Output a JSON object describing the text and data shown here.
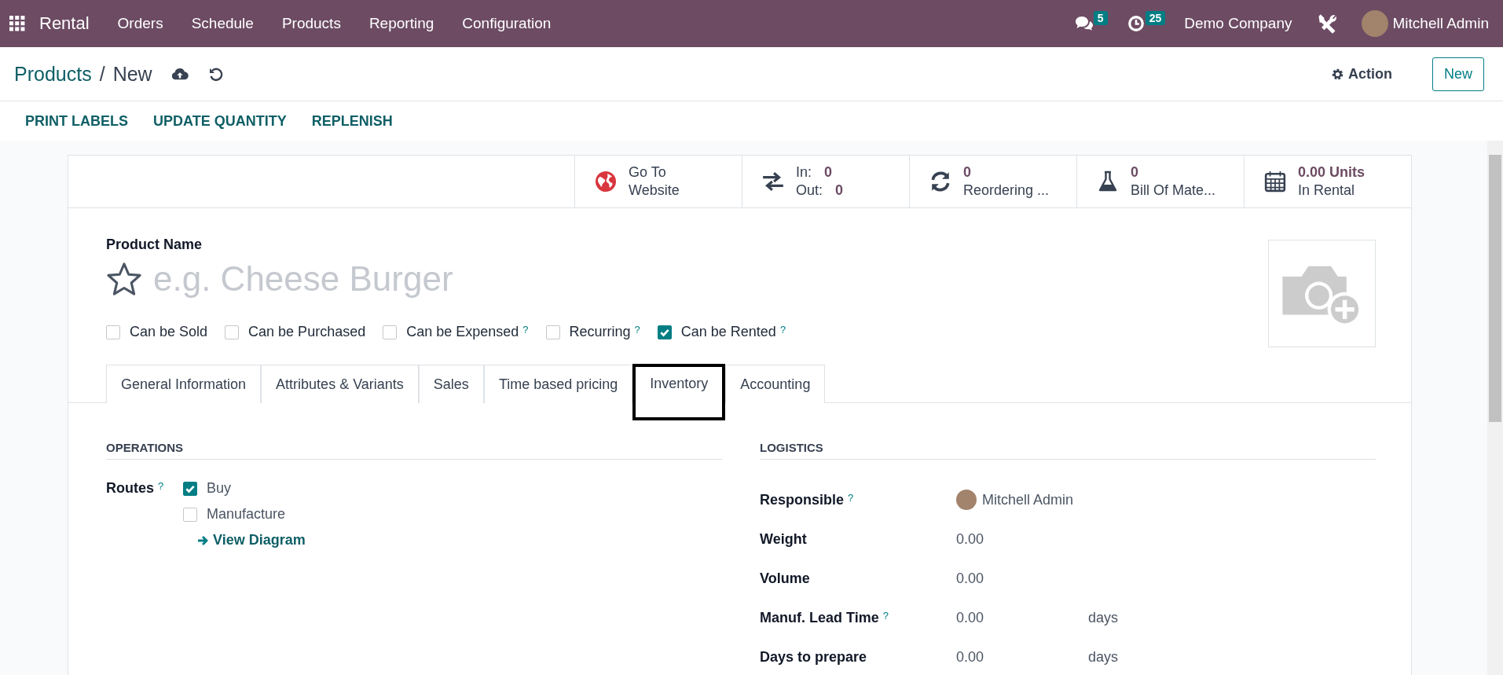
{
  "navbar": {
    "app": "Rental",
    "menu": [
      "Orders",
      "Schedule",
      "Products",
      "Reporting",
      "Configuration"
    ],
    "messages_count": "5",
    "activities_count": "25",
    "company": "Demo Company",
    "user": "Mitchell Admin"
  },
  "breadcrumb": {
    "parent": "Products",
    "separator": "/",
    "current": "New"
  },
  "action": "Action",
  "new_button": "New",
  "toolbar_buttons": [
    "PRINT LABELS",
    "UPDATE QUANTITY",
    "REPLENISH"
  ],
  "smart_buttons": [
    {
      "kind": "globe",
      "lines": [
        {
          "label": "Go To"
        },
        {
          "label": "Website"
        }
      ]
    },
    {
      "kind": "arrows",
      "lines": [
        {
          "label": "In:",
          "value": "0"
        },
        {
          "label": "Out:",
          "value": "0"
        }
      ]
    },
    {
      "kind": "refresh",
      "lines": [
        {
          "value": "0"
        },
        {
          "label": "Reordering ..."
        }
      ]
    },
    {
      "kind": "flask",
      "lines": [
        {
          "value": "0"
        },
        {
          "label": "Bill Of Mate..."
        }
      ]
    },
    {
      "kind": "calendar",
      "lines": [
        {
          "value": "0.00 Units"
        },
        {
          "label": "In Rental"
        }
      ]
    }
  ],
  "product": {
    "label": "Product Name",
    "placeholder": "e.g. Cheese Burger",
    "favorite": false
  },
  "checkboxes": [
    {
      "label": "Can be Sold",
      "checked": false
    },
    {
      "label": "Can be Purchased",
      "checked": false
    },
    {
      "label": "Can be Expensed",
      "checked": false,
      "help": "?"
    },
    {
      "label": "Recurring",
      "checked": false,
      "help": "?"
    },
    {
      "label": "Can be Rented",
      "checked": true,
      "help": "?"
    }
  ],
  "tabs": [
    {
      "label": "General Information",
      "selected": false
    },
    {
      "label": "Attributes & Variants",
      "selected": false
    },
    {
      "label": "Sales",
      "selected": false
    },
    {
      "label": "Time based pricing",
      "selected": false
    },
    {
      "label": "Inventory",
      "selected": true
    },
    {
      "label": "Accounting",
      "selected": false
    }
  ],
  "operations": {
    "title": "OPERATIONS",
    "routes_label": "Routes",
    "help": "?",
    "routes": [
      {
        "label": "Buy",
        "checked": true
      },
      {
        "label": "Manufacture",
        "checked": false
      }
    ],
    "link": "View Diagram"
  },
  "logistics": {
    "title": "LOGISTICS",
    "fields": [
      {
        "kind": "user",
        "label": "Responsible",
        "help": "?",
        "value": "Mitchell Admin"
      },
      {
        "kind": "number",
        "label": "Weight",
        "value": "0.00"
      },
      {
        "kind": "number",
        "label": "Volume",
        "value": "0.00"
      },
      {
        "kind": "number",
        "label": "Manuf. Lead Time",
        "help": "?",
        "value": "0.00",
        "unit": "days"
      },
      {
        "kind": "number",
        "label": "Days to prepare",
        "value": "0.00",
        "unit": "days"
      }
    ]
  }
}
